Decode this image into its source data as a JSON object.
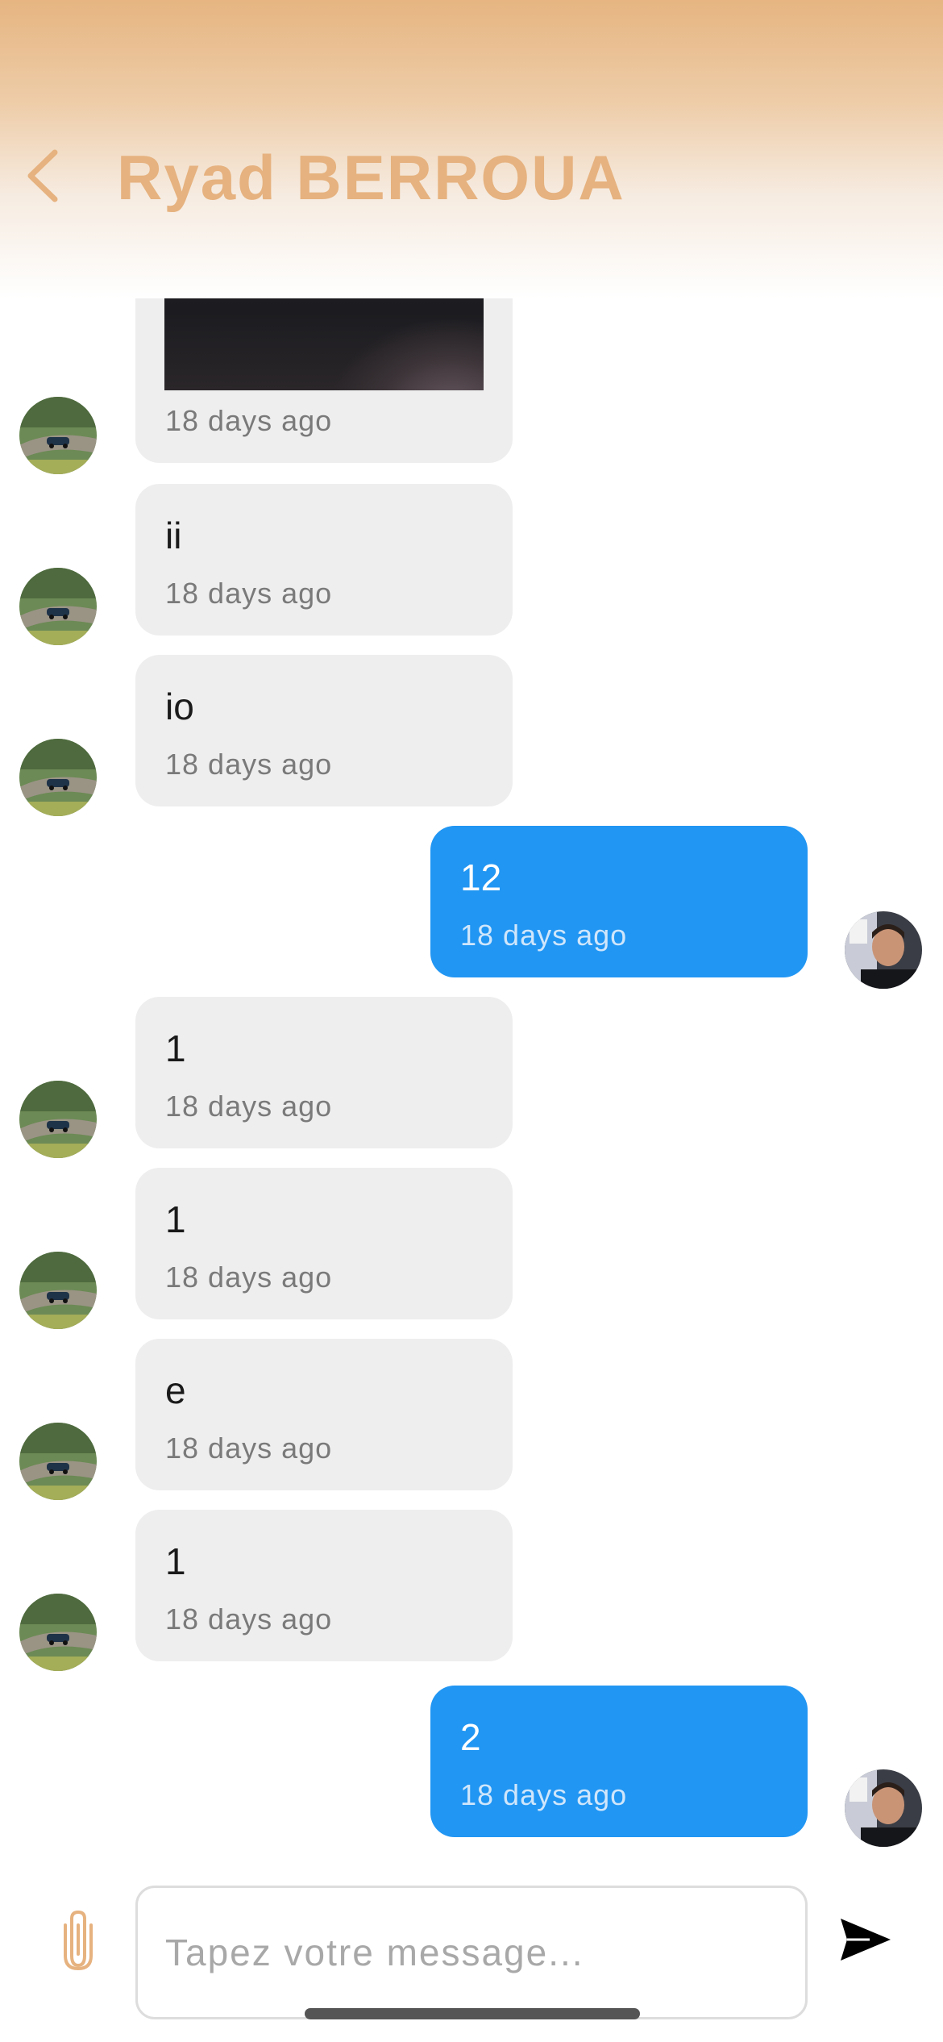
{
  "header": {
    "title": "Ryad BERROUA",
    "back_icon": "chevron-left-icon",
    "color": "#e6b27f"
  },
  "messages": [
    {
      "sender": "contact",
      "type": "image",
      "time": "18 days ago"
    },
    {
      "sender": "contact",
      "type": "text",
      "text": "ii",
      "time": "18 days ago"
    },
    {
      "sender": "contact",
      "type": "text",
      "text": "io",
      "time": "18 days ago"
    },
    {
      "sender": "me",
      "type": "text",
      "text": "12",
      "time": "18 days ago"
    },
    {
      "sender": "contact",
      "type": "text",
      "text": "1",
      "time": "18 days ago"
    },
    {
      "sender": "contact",
      "type": "text",
      "text": "1",
      "time": "18 days ago"
    },
    {
      "sender": "contact",
      "type": "text",
      "text": "e",
      "time": "18 days ago"
    },
    {
      "sender": "contact",
      "type": "text",
      "text": "1",
      "time": "18 days ago"
    },
    {
      "sender": "me",
      "type": "text",
      "text": "2",
      "time": "18 days ago"
    }
  ],
  "composer": {
    "placeholder": "Tapez votre message...",
    "value": "",
    "attach_icon": "paperclip-icon",
    "send_icon": "send-icon"
  },
  "colors": {
    "outgoing_bubble": "#2196f3",
    "incoming_bubble": "#eeeeee",
    "accent": "#e6b27f"
  }
}
